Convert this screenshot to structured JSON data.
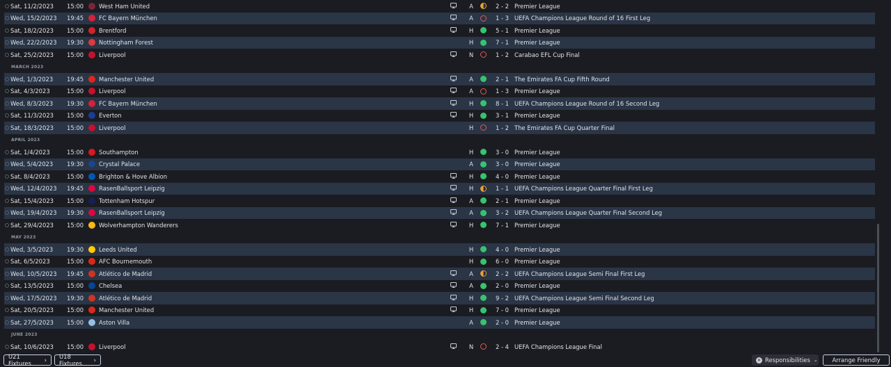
{
  "fixtures": [
    {
      "type": "match",
      "date": "Sat, 11/2/2023",
      "time": "15:00",
      "opponent": "West Ham United",
      "crest": "#7a263a",
      "tv": true,
      "venue": "A",
      "result": "d",
      "score": "2 - 2",
      "competition": "Premier League"
    },
    {
      "type": "match",
      "date": "Wed, 15/2/2023",
      "time": "19:45",
      "opponent": "FC Bayern München",
      "crest": "#d6223a",
      "tv": true,
      "venue": "A",
      "result": "l",
      "score": "1 - 3",
      "competition": "UEFA Champions League Round of 16 First Leg"
    },
    {
      "type": "match",
      "date": "Sat, 18/2/2023",
      "time": "15:00",
      "opponent": "Brentford",
      "crest": "#d2232b",
      "tv": true,
      "venue": "H",
      "result": "w",
      "score": "5 - 1",
      "competition": "Premier League"
    },
    {
      "type": "match",
      "date": "Wed, 22/2/2023",
      "time": "19:30",
      "opponent": "Nottingham Forest",
      "crest": "#e0383e",
      "tv": false,
      "venue": "H",
      "result": "w",
      "score": "7 - 1",
      "competition": "Premier League"
    },
    {
      "type": "match",
      "date": "Sat, 25/2/2023",
      "time": "15:00",
      "opponent": "Liverpool",
      "crest": "#c8102e",
      "tv": true,
      "venue": "N",
      "result": "l",
      "score": "1 - 2",
      "competition": "Carabao EFL Cup Final"
    },
    {
      "type": "header",
      "label": "MARCH 2023"
    },
    {
      "type": "match",
      "date": "Wed, 1/3/2023",
      "time": "19:45",
      "opponent": "Manchester United",
      "crest": "#da291c",
      "tv": true,
      "venue": "A",
      "result": "w",
      "score": "2 - 1",
      "competition": "The Emirates FA Cup Fifth Round"
    },
    {
      "type": "match",
      "date": "Sat, 4/3/2023",
      "time": "15:00",
      "opponent": "Liverpool",
      "crest": "#c8102e",
      "tv": true,
      "venue": "A",
      "result": "l",
      "score": "1 - 3",
      "competition": "Premier League"
    },
    {
      "type": "match",
      "date": "Wed, 8/3/2023",
      "time": "19:30",
      "opponent": "FC Bayern München",
      "crest": "#d6223a",
      "tv": true,
      "venue": "H",
      "result": "w",
      "score": "8 - 1",
      "competition": "UEFA Champions League Round of 16 Second Leg"
    },
    {
      "type": "match",
      "date": "Sat, 11/3/2023",
      "time": "15:00",
      "opponent": "Everton",
      "crest": "#1a3e94",
      "tv": true,
      "venue": "H",
      "result": "w",
      "score": "3 - 1",
      "competition": "Premier League"
    },
    {
      "type": "match",
      "date": "Sat, 18/3/2023",
      "time": "15:00",
      "opponent": "Liverpool",
      "crest": "#c8102e",
      "tv": false,
      "venue": "H",
      "result": "l",
      "score": "1 - 2",
      "competition": "The Emirates FA Cup Quarter Final"
    },
    {
      "type": "header",
      "label": "APRIL 2023"
    },
    {
      "type": "match",
      "date": "Sat, 1/4/2023",
      "time": "15:00",
      "opponent": "Southampton",
      "crest": "#d71920",
      "tv": false,
      "venue": "H",
      "result": "w",
      "score": "3 - 0",
      "competition": "Premier League"
    },
    {
      "type": "match",
      "date": "Wed, 5/4/2023",
      "time": "19:30",
      "opponent": "Crystal Palace",
      "crest": "#1b458f",
      "tv": false,
      "venue": "A",
      "result": "w",
      "score": "3 - 0",
      "competition": "Premier League"
    },
    {
      "type": "match",
      "date": "Sat, 8/4/2023",
      "time": "15:00",
      "opponent": "Brighton & Hove Albion",
      "crest": "#0057b8",
      "tv": true,
      "venue": "H",
      "result": "w",
      "score": "4 - 0",
      "competition": "Premier League"
    },
    {
      "type": "match",
      "date": "Wed, 12/4/2023",
      "time": "19:45",
      "opponent": "RasenBallsport Leipzig",
      "crest": "#dd0741",
      "tv": true,
      "venue": "H",
      "result": "d",
      "score": "1 - 1",
      "competition": "UEFA Champions League Quarter Final First Leg"
    },
    {
      "type": "match",
      "date": "Sat, 15/4/2023",
      "time": "15:00",
      "opponent": "Tottenham Hotspur",
      "crest": "#132257",
      "tv": true,
      "venue": "A",
      "result": "w",
      "score": "2 - 1",
      "competition": "Premier League"
    },
    {
      "type": "match",
      "date": "Wed, 19/4/2023",
      "time": "19:30",
      "opponent": "RasenBallsport Leipzig",
      "crest": "#dd0741",
      "tv": true,
      "venue": "A",
      "result": "w",
      "score": "3 - 2",
      "competition": "UEFA Champions League Quarter Final Second Leg"
    },
    {
      "type": "match",
      "date": "Sat, 29/4/2023",
      "time": "15:00",
      "opponent": "Wolverhampton Wanderers",
      "crest": "#fdb913",
      "tv": true,
      "venue": "H",
      "result": "w",
      "score": "7 - 1",
      "competition": "Premier League"
    },
    {
      "type": "header",
      "label": "MAY 2023"
    },
    {
      "type": "match",
      "date": "Wed, 3/5/2023",
      "time": "19:30",
      "opponent": "Leeds United",
      "crest": "#ffcd00",
      "tv": false,
      "venue": "H",
      "result": "w",
      "score": "4 - 0",
      "competition": "Premier League"
    },
    {
      "type": "match",
      "date": "Sat, 6/5/2023",
      "time": "15:00",
      "opponent": "AFC Bournemouth",
      "crest": "#da291c",
      "tv": false,
      "venue": "H",
      "result": "w",
      "score": "6 - 0",
      "competition": "Premier League"
    },
    {
      "type": "match",
      "date": "Wed, 10/5/2023",
      "time": "19:45",
      "opponent": "Atlético de Madrid",
      "crest": "#cb3524",
      "tv": true,
      "venue": "A",
      "result": "d",
      "score": "2 - 2",
      "competition": "UEFA Champions League Semi Final First Leg"
    },
    {
      "type": "match",
      "date": "Sat, 13/5/2023",
      "time": "15:00",
      "opponent": "Chelsea",
      "crest": "#034694",
      "tv": true,
      "venue": "A",
      "result": "w",
      "score": "2 - 0",
      "competition": "Premier League"
    },
    {
      "type": "match",
      "date": "Wed, 17/5/2023",
      "time": "19:30",
      "opponent": "Atlético de Madrid",
      "crest": "#cb3524",
      "tv": true,
      "venue": "H",
      "result": "w",
      "score": "9 - 2",
      "competition": "UEFA Champions League Semi Final Second Leg"
    },
    {
      "type": "match",
      "date": "Sat, 20/5/2023",
      "time": "15:00",
      "opponent": "Manchester United",
      "crest": "#da291c",
      "tv": true,
      "venue": "H",
      "result": "w",
      "score": "7 - 0",
      "competition": "Premier League"
    },
    {
      "type": "match",
      "date": "Sat, 27/5/2023",
      "time": "15:00",
      "opponent": "Aston Villa",
      "crest": "#95bfe5",
      "tv": false,
      "venue": "A",
      "result": "w",
      "score": "2 - 0",
      "competition": "Premier League"
    },
    {
      "type": "header",
      "label": "JUNE 2023"
    },
    {
      "type": "match",
      "date": "Sat, 10/6/2023",
      "time": "15:00",
      "opponent": "Liverpool",
      "crest": "#c8102e",
      "tv": true,
      "venue": "N",
      "result": "l",
      "score": "2 - 4",
      "competition": "UEFA Champions League Final"
    }
  ],
  "footer": {
    "u21_label": "U21 Fixtures",
    "u18_label": "U18 Fixtures",
    "responsibilities_label": "Responsibilities",
    "arrange_label": "Arrange Friendly"
  },
  "colors": {
    "win": "#36c46e",
    "loss": "#e05a5a",
    "draw": "#e8a23a",
    "row_alt": "#2a3546",
    "accent_border": "#c5d4e6"
  }
}
